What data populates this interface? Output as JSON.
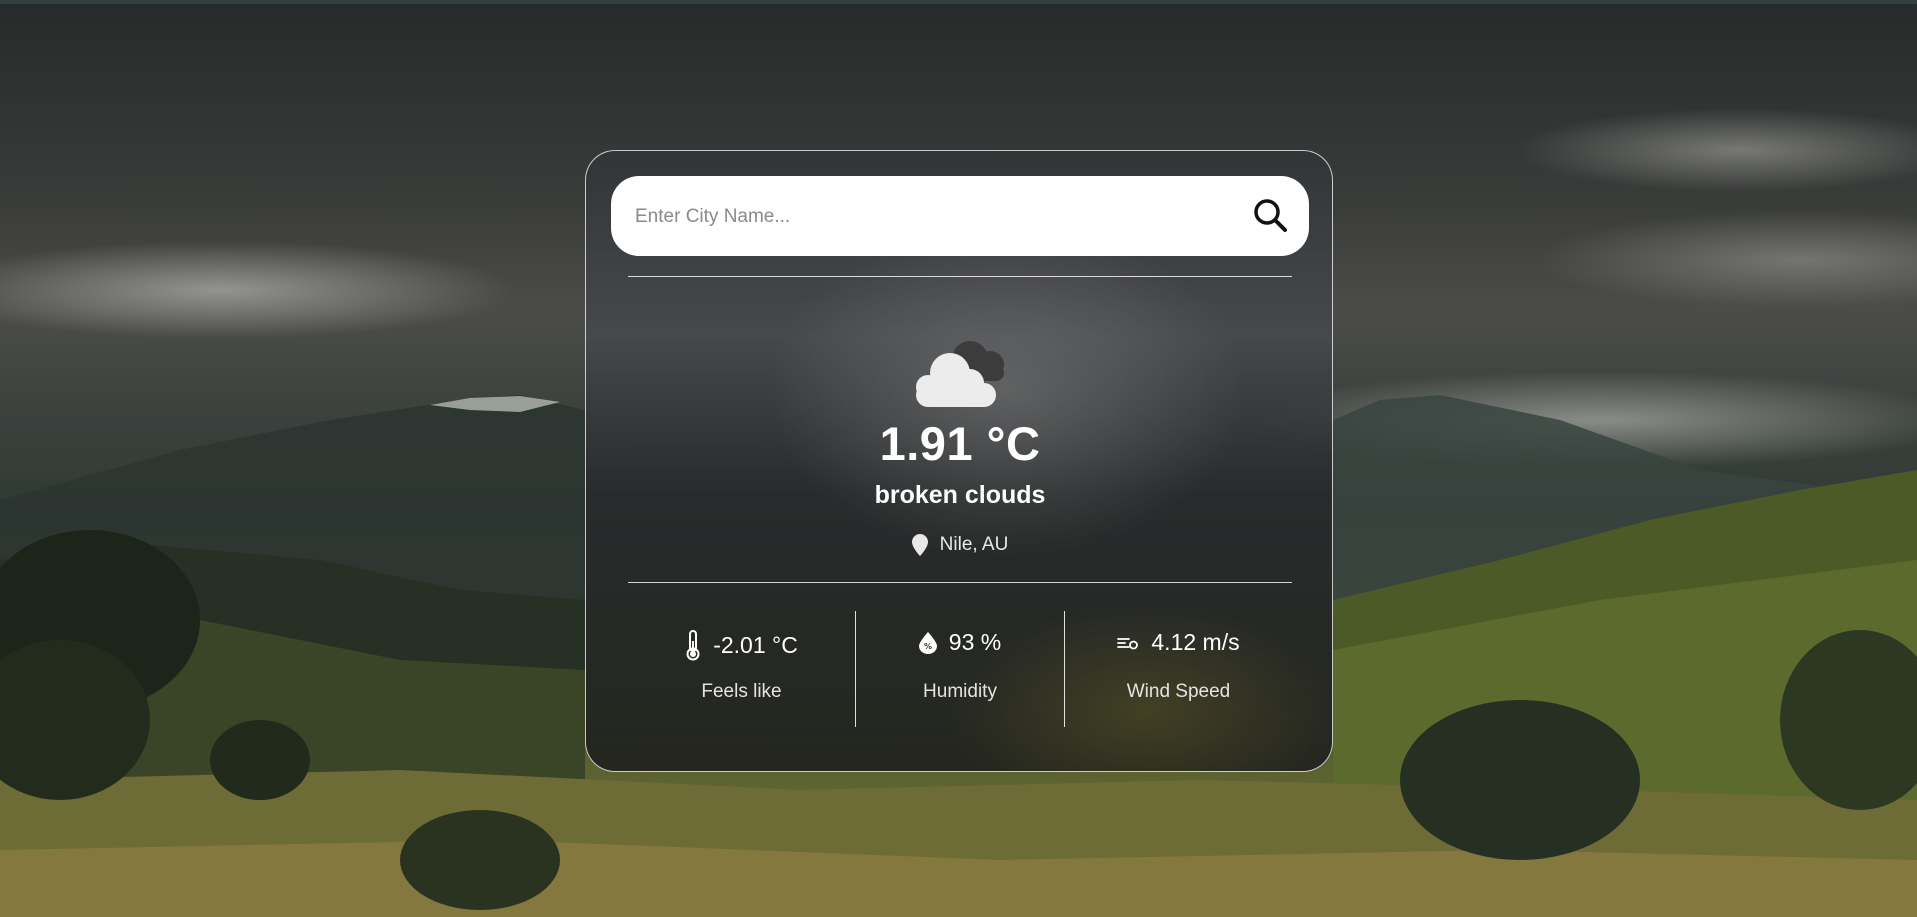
{
  "search": {
    "placeholder": "Enter City Name...",
    "value": ""
  },
  "weather": {
    "icon": "broken-clouds-icon",
    "temperature": "1.91 °C",
    "description": "broken clouds",
    "location": "Nile, AU"
  },
  "stats": [
    {
      "icon": "thermometer-icon",
      "value": "-2.01 °C",
      "label": "Feels like"
    },
    {
      "icon": "humidity-icon",
      "value": "93 %",
      "label": "Humidity"
    },
    {
      "icon": "wind-icon",
      "value": "4.12 m/s",
      "label": "Wind Speed"
    }
  ],
  "colors": {
    "card_border": "#ffffff",
    "search_bg": "#ffffff",
    "text": "#ffffff"
  }
}
